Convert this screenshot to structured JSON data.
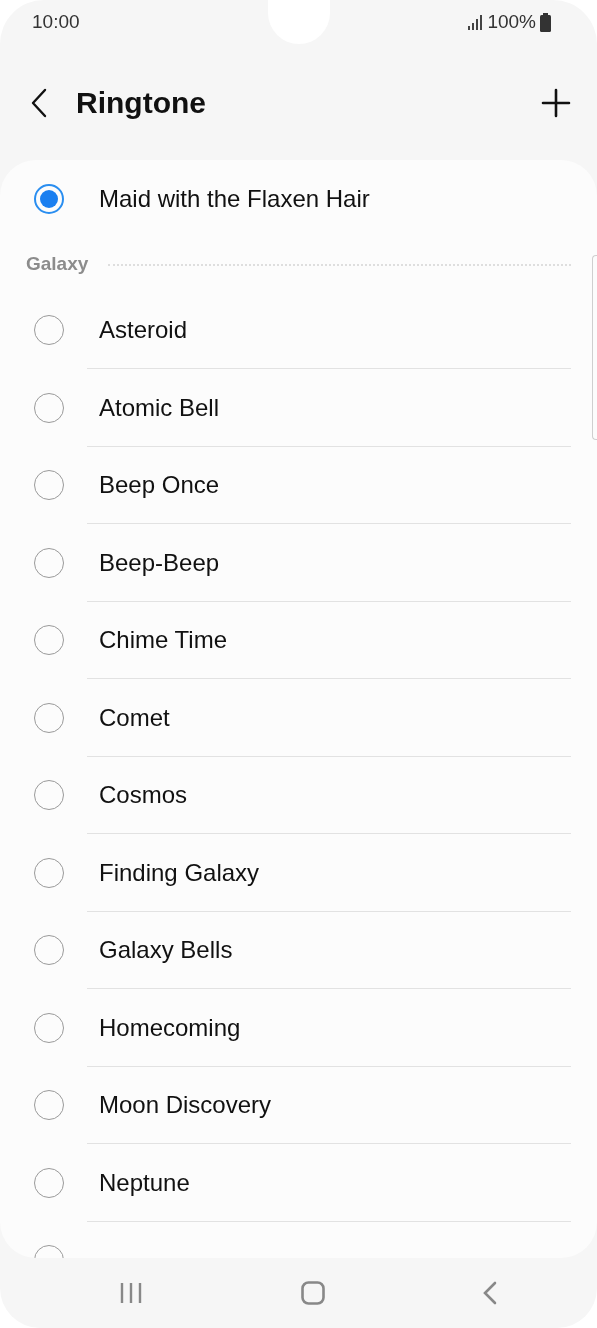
{
  "status_bar": {
    "time": "10:00",
    "battery": "100%"
  },
  "header": {
    "title": "Ringtone"
  },
  "current": {
    "label": "Maid with the Flaxen Hair",
    "selected": true
  },
  "section": {
    "title": "Galaxy"
  },
  "ringtones": [
    {
      "label": "Asteroid",
      "selected": false
    },
    {
      "label": "Atomic Bell",
      "selected": false
    },
    {
      "label": "Beep Once",
      "selected": false
    },
    {
      "label": "Beep-Beep",
      "selected": false
    },
    {
      "label": "Chime Time",
      "selected": false
    },
    {
      "label": "Comet",
      "selected": false
    },
    {
      "label": "Cosmos",
      "selected": false
    },
    {
      "label": "Finding Galaxy",
      "selected": false
    },
    {
      "label": "Galaxy Bells",
      "selected": false
    },
    {
      "label": "Homecoming",
      "selected": false
    },
    {
      "label": "Moon Discovery",
      "selected": false
    },
    {
      "label": "Neptune",
      "selected": false
    },
    {
      "selected": false
    }
  ]
}
